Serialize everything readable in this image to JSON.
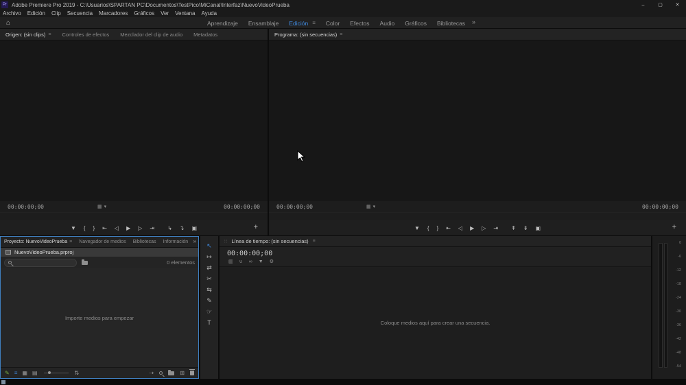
{
  "titlebar": {
    "app_badge": "Pr",
    "title": "Adobe Premiere Pro 2019 - C:\\Usuarios\\SPARTAN PC\\Documentos\\TestPico\\MiCanal\\Interfaz\\NuevoVideoPrueba",
    "minimize": "–",
    "maximize": "▢",
    "close": "✕"
  },
  "menubar": {
    "items": [
      "Archivo",
      "Edición",
      "Clip",
      "Secuencia",
      "Marcadores",
      "Gráficos",
      "Ver",
      "Ventana",
      "Ayuda"
    ]
  },
  "workspacebar": {
    "home_icon": "⌂",
    "tabs": [
      "Aprendizaje",
      "Ensamblaje",
      "Edición",
      "Color",
      "Efectos",
      "Audio",
      "Gráficos",
      "Bibliotecas"
    ],
    "menu_icon": "≡",
    "overflow_icon": "»"
  },
  "monitors": {
    "source": {
      "tabs": [
        "Origen: (sin clips)",
        "Controles de efectos",
        "Mezclador del clip de audio",
        "Metadatos"
      ],
      "timecode_left": "00:00:00;00",
      "timecode_right": "00:00:00;00"
    },
    "program": {
      "tabs": [
        "Programa: (sin secuencias)"
      ],
      "timecode_left": "00:00:00;00",
      "timecode_right": "00:00:00;00"
    },
    "panel_menu_icon": "≡",
    "fit_icon": "▦",
    "fit_caret": "▾",
    "transport": {
      "add_marker": "▼",
      "mark_in": "{",
      "mark_out": "}",
      "go_to_in": "⇤",
      "step_back": "◁",
      "play": "▶",
      "step_forward": "▷",
      "go_to_out": "⇥",
      "insert": "↳",
      "overwrite": "↴",
      "lift": "⇞",
      "extract": "⇟",
      "export_frame": "▣",
      "add_button": "+"
    }
  },
  "project": {
    "tabs": [
      "Proyecto: NuevoVideoPrueba",
      "Navegador de medios",
      "Bibliotecas",
      "Información"
    ],
    "panel_menu_icon": "≡",
    "overflow_icon": "»",
    "item_name": "NuevoVideoPrueba.prproj",
    "search_placeholder": "",
    "items_count": "0 elementos",
    "empty_text": "Importe medios para empezar",
    "toolbar": {
      "writable_icon": "✎",
      "list_view_icon": "≡",
      "icon_view_icon": "▦",
      "freeform_view_icon": "▤",
      "sort_icon": "⇅",
      "automate_icon": "⇢",
      "new_item_icon": "⊞"
    }
  },
  "tools": {
    "items": [
      {
        "name": "selection",
        "glyph": "↖"
      },
      {
        "name": "track-select",
        "glyph": "↦"
      },
      {
        "name": "ripple-edit",
        "glyph": "⇄"
      },
      {
        "name": "razor",
        "glyph": "✂"
      },
      {
        "name": "slip",
        "glyph": "⇆"
      },
      {
        "name": "pen",
        "glyph": "✎"
      },
      {
        "name": "hand",
        "glyph": "☞"
      },
      {
        "name": "type",
        "glyph": "T"
      }
    ]
  },
  "timeline": {
    "grip_icon": "∷",
    "tab": "Línea de tiempo: (sin secuencias)",
    "panel_menu_icon": "≡",
    "timecode": "00:00:00;00",
    "toolbar": {
      "nest_icon": "▥",
      "snap_icon": "∪",
      "linked_icon": "∞",
      "marker_icon": "▼",
      "settings_icon": "⚙"
    },
    "empty_text": "Coloque medios aquí para crear una secuencia."
  },
  "audio_meters": {
    "scale": [
      "0",
      "-6",
      "-12",
      "-18",
      "-24",
      "-30",
      "-36",
      "-42",
      "-48",
      "-54"
    ]
  }
}
